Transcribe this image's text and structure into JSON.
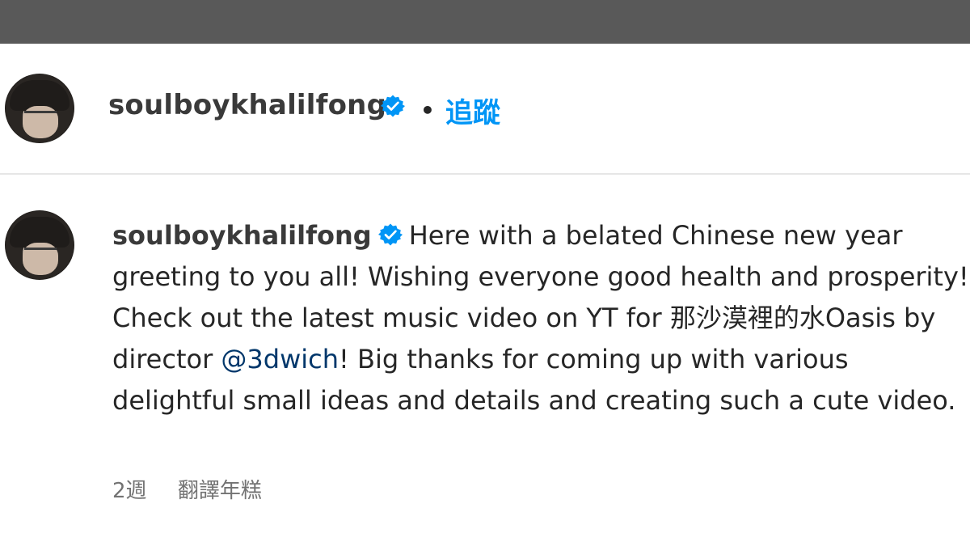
{
  "header": {
    "username": "soulboykhalilfong",
    "separator": "•",
    "follow_label": "追蹤"
  },
  "post": {
    "username": "soulboykhalilfong",
    "caption_before_mention": "Here with a belated Chinese new year greeting to you all! Wishing everyone good health and prosperity! Check out the latest music video on YT for 那沙漠裡的水Oasis by director ",
    "mention": "@3dwich",
    "caption_after_mention": "! Big thanks for coming up with various delightful small ideas and details and creating such a cute video.",
    "timestamp": "2週",
    "translate_label": "翻譯年糕"
  },
  "colors": {
    "topbar": "#595959",
    "accent": "#0095f6",
    "verified": "#0095f6",
    "mention": "#00376b"
  },
  "icons": {
    "verified": "verified-badge-icon"
  }
}
